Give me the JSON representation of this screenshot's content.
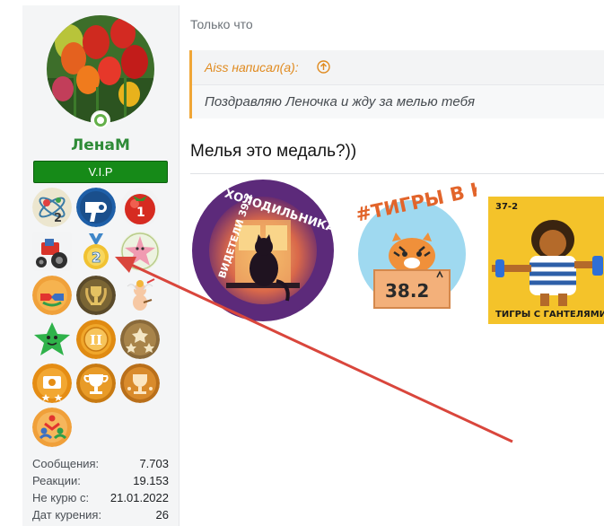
{
  "user": {
    "name": "ЛенаМ",
    "badge": "V.I.P",
    "stats": [
      {
        "label": "Сообщения:",
        "value": "7.703"
      },
      {
        "label": "Реакции:",
        "value": "19.153"
      },
      {
        "label": "Не курю с:",
        "value": "21.01.2022"
      },
      {
        "label": "Дат курения:",
        "value": "26"
      }
    ]
  },
  "medals": [
    {
      "icon": "atom-icon",
      "number": "2"
    },
    {
      "icon": "hairdryer-icon"
    },
    {
      "icon": "tomato-medal-icon",
      "number": "1"
    },
    {
      "icon": "tractor-icon"
    },
    {
      "icon": "gold-medal-2-icon",
      "number": "2"
    },
    {
      "icon": "starfish-icon"
    },
    {
      "icon": "handshake-badge-icon"
    },
    {
      "icon": "laurel-trophy-icon"
    },
    {
      "icon": "cupid-icon"
    },
    {
      "icon": "green-star-icon"
    },
    {
      "icon": "roman-two-medal-icon",
      "number": "II"
    },
    {
      "icon": "stars-badge-icon"
    },
    {
      "icon": "camera-badge-icon"
    },
    {
      "icon": "trophy-badge-icon"
    },
    {
      "icon": "trophy-badge-alt-icon"
    },
    {
      "icon": "people-badge-icon"
    }
  ],
  "post": {
    "time": "Только что",
    "quote_author": "Aiss написал(а):",
    "quote_text": "Поздравляю Леночка и жду за мелью тебя",
    "message": "Мелья это медаль?))"
  },
  "images": {
    "holo_text": "ХОЛОДИЛЬНИКА",
    "holo_text2": "ВИДЕТЕЛИ 39.2",
    "tiger_hashtag": "#ТИГРЫ В КУБЕ",
    "tiger_box": "38.2",
    "gant_top": "37-2",
    "gant_caption": "ТИГРЫ С ГАНТЕЛЯМИ"
  },
  "colors": {
    "username": "#2e8b37",
    "vip_bg": "#168a18",
    "quote_border": "#f0a636",
    "arrow": "#d9463c"
  }
}
